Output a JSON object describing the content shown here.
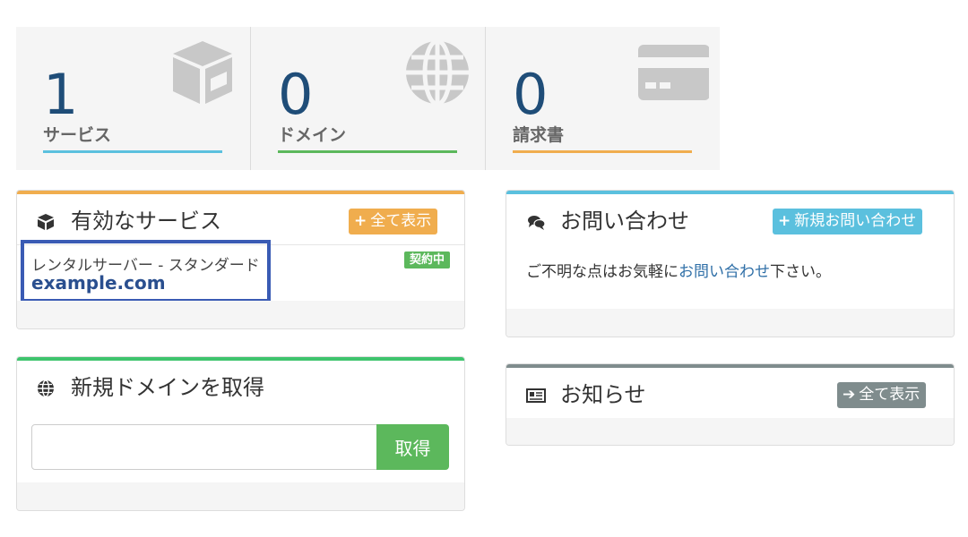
{
  "stats": [
    {
      "count": "1",
      "label": "サービス",
      "color": "#5bc0de",
      "icon": "box-icon"
    },
    {
      "count": "0",
      "label": "ドメイン",
      "color": "#5cb85c",
      "icon": "globe-icon"
    },
    {
      "count": "0",
      "label": "請求書",
      "color": "#f0ad4e",
      "icon": "credit-card-icon"
    }
  ],
  "services_panel": {
    "title": "有効なサービス",
    "view_all": "全て表示",
    "accent": "#f0ad4e",
    "item": {
      "plan": "レンタルサーバー - スタンダード",
      "domain": "example.com",
      "status": "契約中"
    }
  },
  "domain_panel": {
    "title": "新規ドメインを取得",
    "accent": "#3ec46d",
    "input_value": "",
    "button": "取得"
  },
  "contact_panel": {
    "title": "お問い合わせ",
    "new_button": "新規お問い合わせ",
    "accent": "#5bc0de",
    "text_before": "ご不明な点はお気軽に",
    "text_link": "お問い合わせ",
    "text_after": "下さい。"
  },
  "news_panel": {
    "title": "お知らせ",
    "view_all": "全て表示",
    "accent": "#7f8c8d"
  }
}
